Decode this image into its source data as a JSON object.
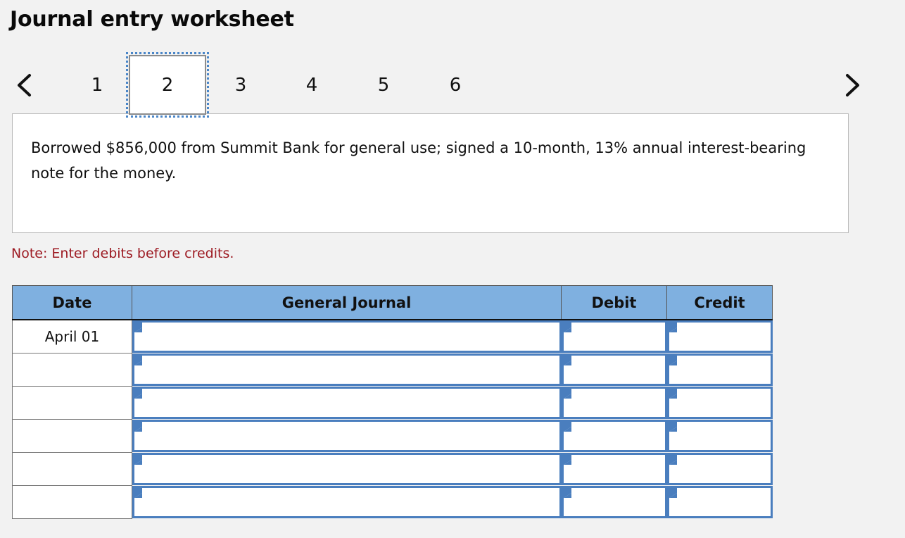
{
  "page": {
    "title": "Journal entry worksheet",
    "background_color": "#f2f2f2"
  },
  "pager": {
    "prev_label": "‹",
    "next_label": "›",
    "prev_icon": "chevron-left-icon",
    "next_icon": "chevron-right-icon",
    "active_index": 1,
    "tabs": [
      {
        "label": "1",
        "active": false
      },
      {
        "label": "2",
        "active": true
      },
      {
        "label": "3",
        "active": false
      },
      {
        "label": "4",
        "active": false
      },
      {
        "label": "5",
        "active": false
      },
      {
        "label": "6",
        "active": false
      }
    ]
  },
  "description": {
    "text": "Borrowed $856,000 from Summit Bank for general use; signed a 10-month, 13% annual interest-bearing note for the money."
  },
  "note": {
    "text": "Note: Enter debits before credits."
  },
  "table": {
    "header_color": "#7fb0e0",
    "input_border_color": "#4a7ebe",
    "columns": [
      "Date",
      "General Journal",
      "Debit",
      "Credit"
    ],
    "rows": [
      {
        "date": "April 01",
        "general_journal": "",
        "debit": "",
        "credit": ""
      },
      {
        "date": "",
        "general_journal": "",
        "debit": "",
        "credit": ""
      },
      {
        "date": "",
        "general_journal": "",
        "debit": "",
        "credit": ""
      },
      {
        "date": "",
        "general_journal": "",
        "debit": "",
        "credit": ""
      },
      {
        "date": "",
        "general_journal": "",
        "debit": "",
        "credit": ""
      },
      {
        "date": "",
        "general_journal": "",
        "debit": "",
        "credit": ""
      }
    ]
  }
}
